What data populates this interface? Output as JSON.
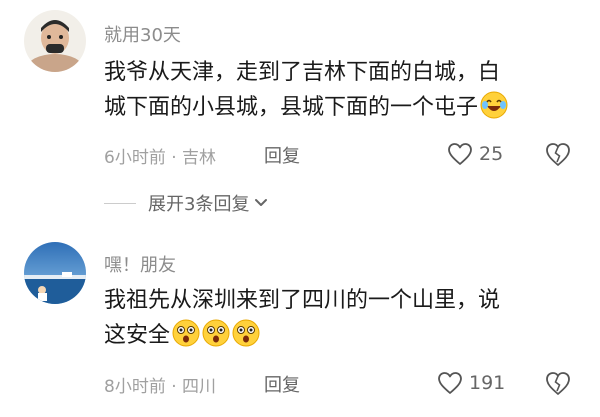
{
  "comments": [
    {
      "username": "就用30天",
      "text_lines": [
        "我爷从天津，走到了吉林下面的白城，白",
        "城下面的小县城，县城下面的一个屯子"
      ],
      "emojis": [
        "laughing-crying-emoji"
      ],
      "meta": "6小时前 · 吉林",
      "reply_label": "回复",
      "like_count": "25"
    },
    {
      "username": "嘿！朋友",
      "text_lines": [
        "我祖先从深圳来到了四川的一个山里，说",
        "这安全"
      ],
      "emojis": [
        "shocked-emoji",
        "shocked-emoji",
        "shocked-emoji"
      ],
      "meta": "8小时前 · 四川",
      "reply_label": "回复",
      "like_count": "191"
    }
  ],
  "expand_replies": {
    "label": "展开3条回复"
  },
  "colors": {
    "secondary_text": "#8c8c8c",
    "action_text": "#666666",
    "emoji_yellow": "#ffd13b"
  }
}
